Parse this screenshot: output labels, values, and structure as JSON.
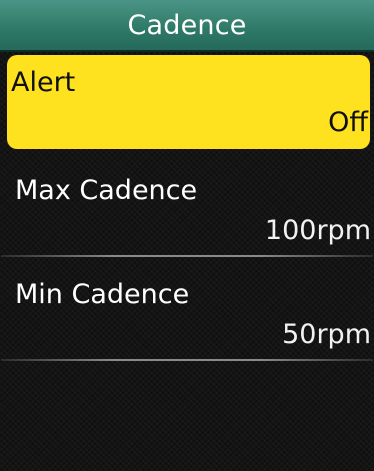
{
  "header": {
    "title": "Cadence"
  },
  "menu": {
    "items": [
      {
        "label": "Alert",
        "value": "Off"
      },
      {
        "label": "Max Cadence",
        "value": "100rpm"
      },
      {
        "label": "Min Cadence",
        "value": "50rpm"
      }
    ]
  }
}
